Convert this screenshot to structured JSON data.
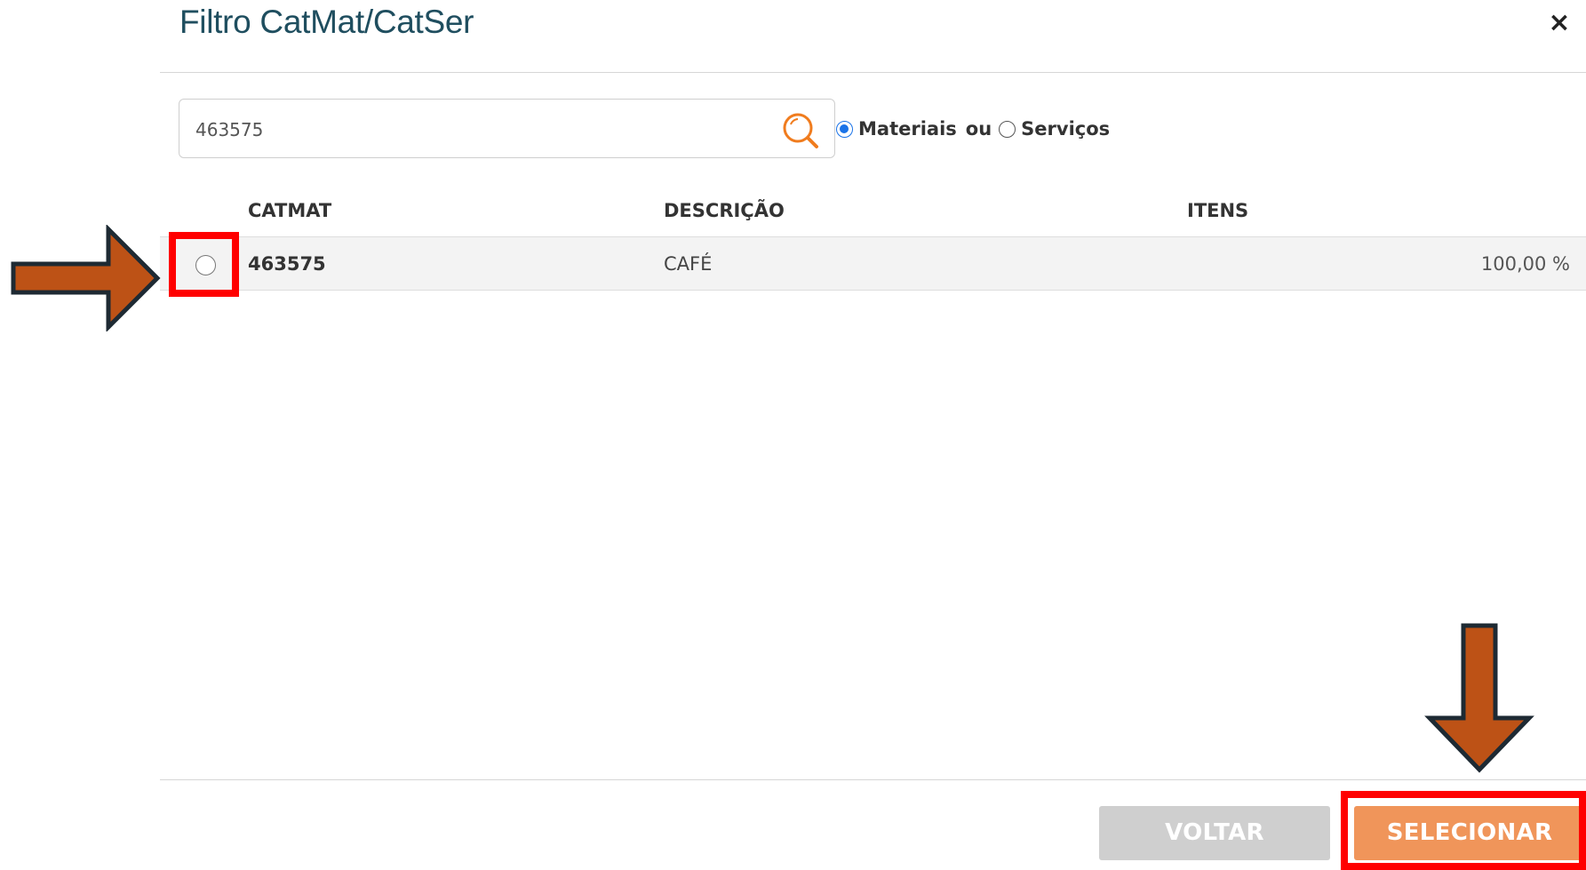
{
  "modal": {
    "title": "Filtro CatMat/CatSer",
    "close_label": "×"
  },
  "search": {
    "value": "463575",
    "placeholder": ""
  },
  "filter": {
    "materiais_label": "Materiais",
    "or_label": "ou",
    "servicos_label": "Serviços",
    "selected": "Materiais"
  },
  "table": {
    "columns": [
      "CATMAT",
      "DESCRIÇÃO",
      "ITENS"
    ],
    "rows": [
      {
        "code": "463575",
        "description": "CAFÉ",
        "percent": "100,00 %",
        "selected": false
      }
    ]
  },
  "footer": {
    "back_label": "VOLTAR",
    "select_label": "SELECIONAR"
  },
  "colors": {
    "title": "#1f4e5f",
    "accent_orange": "#f0955a",
    "search_icon": "#f07c1e",
    "disabled_button": "#cfcfcf",
    "highlight": "#ff0000",
    "arrow_fill": "#bd5216",
    "arrow_stroke": "#1e2a33",
    "radio_selected": "#1a73e8"
  },
  "icons": {
    "search": "search-icon",
    "close": "close-icon"
  }
}
